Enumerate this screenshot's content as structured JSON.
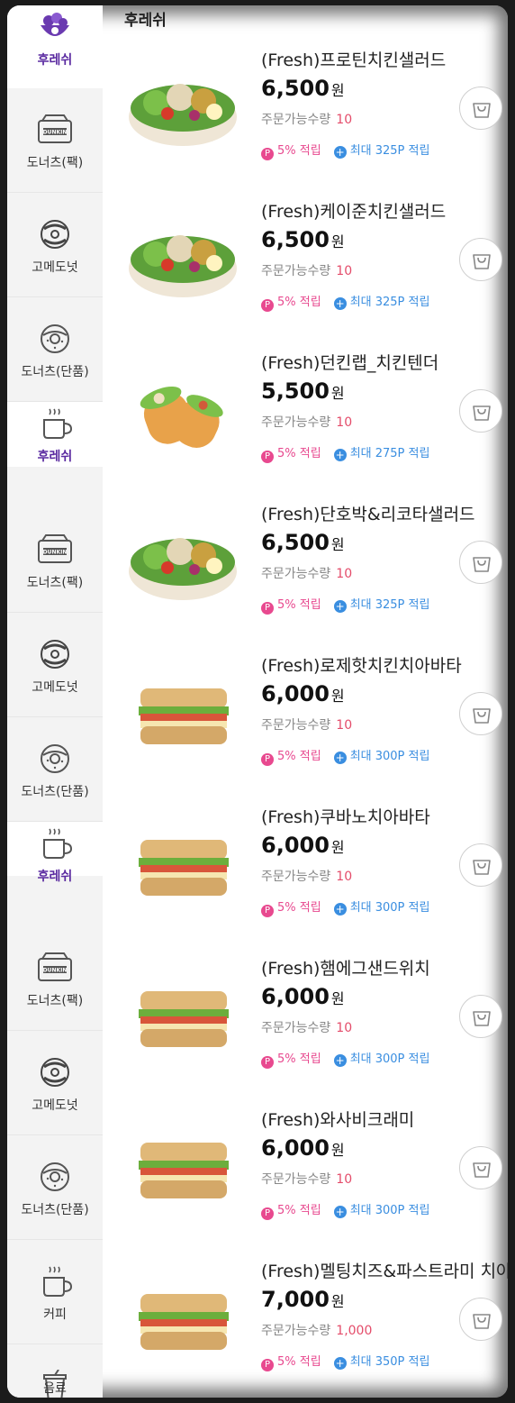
{
  "category_title": "후레쉬",
  "sidebar": [
    {
      "label": "후레쉬",
      "icon": "salad-bowl-icon",
      "active": true
    },
    {
      "label": "도너츠(팩)",
      "icon": "donut-box-icon"
    },
    {
      "label": "고메도넛",
      "icon": "gourmet-donut-icon"
    },
    {
      "label": "도너츠(단품)",
      "icon": "donut-icon"
    },
    {
      "label": "후레쉬",
      "icon": "coffee-cup-icon",
      "active": true
    },
    {
      "label": "도너츠(팩)",
      "icon": "donut-box-icon"
    },
    {
      "label": "고메도넛",
      "icon": "gourmet-donut-icon"
    },
    {
      "label": "도너츠(단품)",
      "icon": "donut-icon"
    },
    {
      "label": "후레쉬",
      "icon": "coffee-cup-icon",
      "active": true
    },
    {
      "label": "도너츠(팩)",
      "icon": "donut-box-icon"
    },
    {
      "label": "고메도넛",
      "icon": "gourmet-donut-icon"
    },
    {
      "label": "도너츠(단품)",
      "icon": "donut-icon"
    },
    {
      "label": "커피",
      "icon": "coffee-cup-icon"
    },
    {
      "label": "음료",
      "icon": "drink-cup-icon"
    }
  ],
  "product_labels": {
    "stock_label": "주문가능수량",
    "won": "원",
    "rate": "5% 적립",
    "p_glyph": "P",
    "plus_glyph": "+"
  },
  "products": [
    {
      "name": "(Fresh)프로틴치킨샐러드",
      "price": "6,500",
      "qty": "10",
      "max": "최대 325P 적립",
      "image": "salad"
    },
    {
      "name": "(Fresh)케이준치킨샐러드",
      "price": "6,500",
      "qty": "10",
      "max": "최대 325P 적립",
      "image": "salad"
    },
    {
      "name": "(Fresh)던킨랩_치킨텐더",
      "price": "5,500",
      "qty": "10",
      "max": "최대 275P 적립",
      "image": "wrap"
    },
    {
      "name": "(Fresh)단호박&리코타샐러드",
      "price": "6,500",
      "qty": "10",
      "max": "최대 325P 적립",
      "image": "salad"
    },
    {
      "name": "(Fresh)로제핫치킨치아바타",
      "price": "6,000",
      "qty": "10",
      "max": "최대 300P 적립",
      "image": "sandwich"
    },
    {
      "name": "(Fresh)쿠바노치아바타",
      "price": "6,000",
      "qty": "10",
      "max": "최대 300P 적립",
      "image": "sandwich"
    },
    {
      "name": "(Fresh)햄에그샌드위치",
      "price": "6,000",
      "qty": "10",
      "max": "최대 300P 적립",
      "image": "sandwich"
    },
    {
      "name": "(Fresh)와사비크래미",
      "price": "6,000",
      "qty": "10",
      "max": "최대 300P 적립",
      "image": "sandwich"
    },
    {
      "name": "(Fresh)멜팅치즈&파스트라미 치아바타",
      "price": "7,000",
      "qty": "1,000",
      "max": "최대 350P 적립",
      "image": "sandwich"
    }
  ],
  "colors": {
    "accent": "#5a2aa0",
    "pink": "#e8498f",
    "blue": "#3a8ee0",
    "qty": "#e44c6a"
  }
}
